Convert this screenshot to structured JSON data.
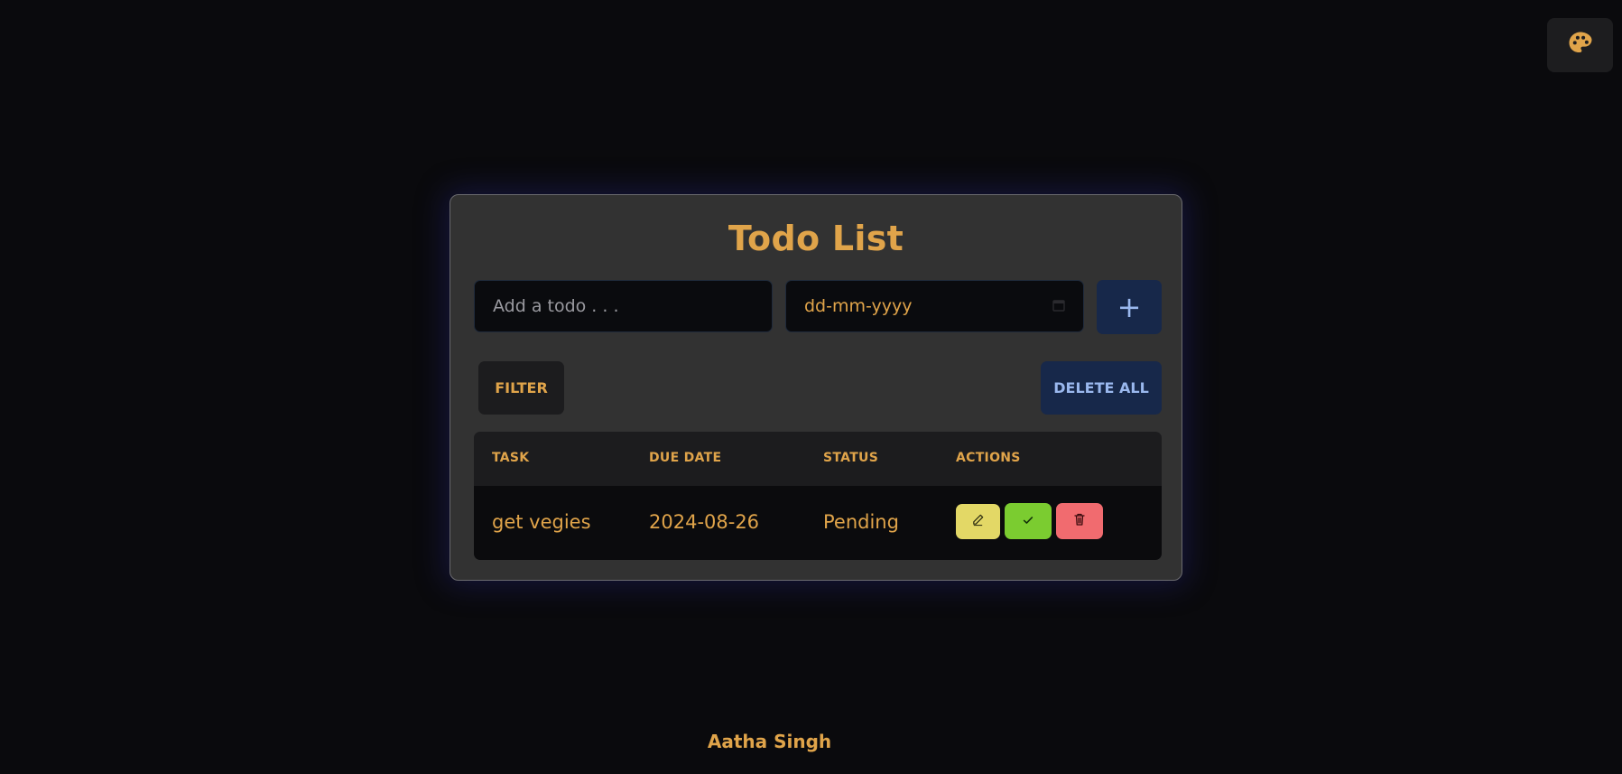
{
  "app": {
    "title": "Todo List"
  },
  "theme_button": {
    "icon": "palette-icon"
  },
  "form": {
    "todo_placeholder": "Add a todo . . .",
    "date_placeholder": "dd-mm-yyyy",
    "add_label": "+"
  },
  "toolbar": {
    "filter_label": "FILTER",
    "delete_all_label": "DELETE ALL"
  },
  "table": {
    "headers": {
      "task": "TASK",
      "due_date": "DUE DATE",
      "status": "STATUS",
      "actions": "ACTIONS"
    },
    "rows": [
      {
        "task": "get vegies",
        "due_date": "2024-08-26",
        "status": "Pending",
        "actions": [
          "edit-icon",
          "check-icon",
          "trash-icon"
        ]
      }
    ]
  },
  "footer": {
    "author": "Aatha Singh"
  },
  "colors": {
    "accent": "#e0a44a",
    "background": "#0a0a0d",
    "card": "#323232",
    "primary_button": "#17284a",
    "edit": "#e3d866",
    "complete": "#7bcc30",
    "delete": "#f16b6f"
  }
}
